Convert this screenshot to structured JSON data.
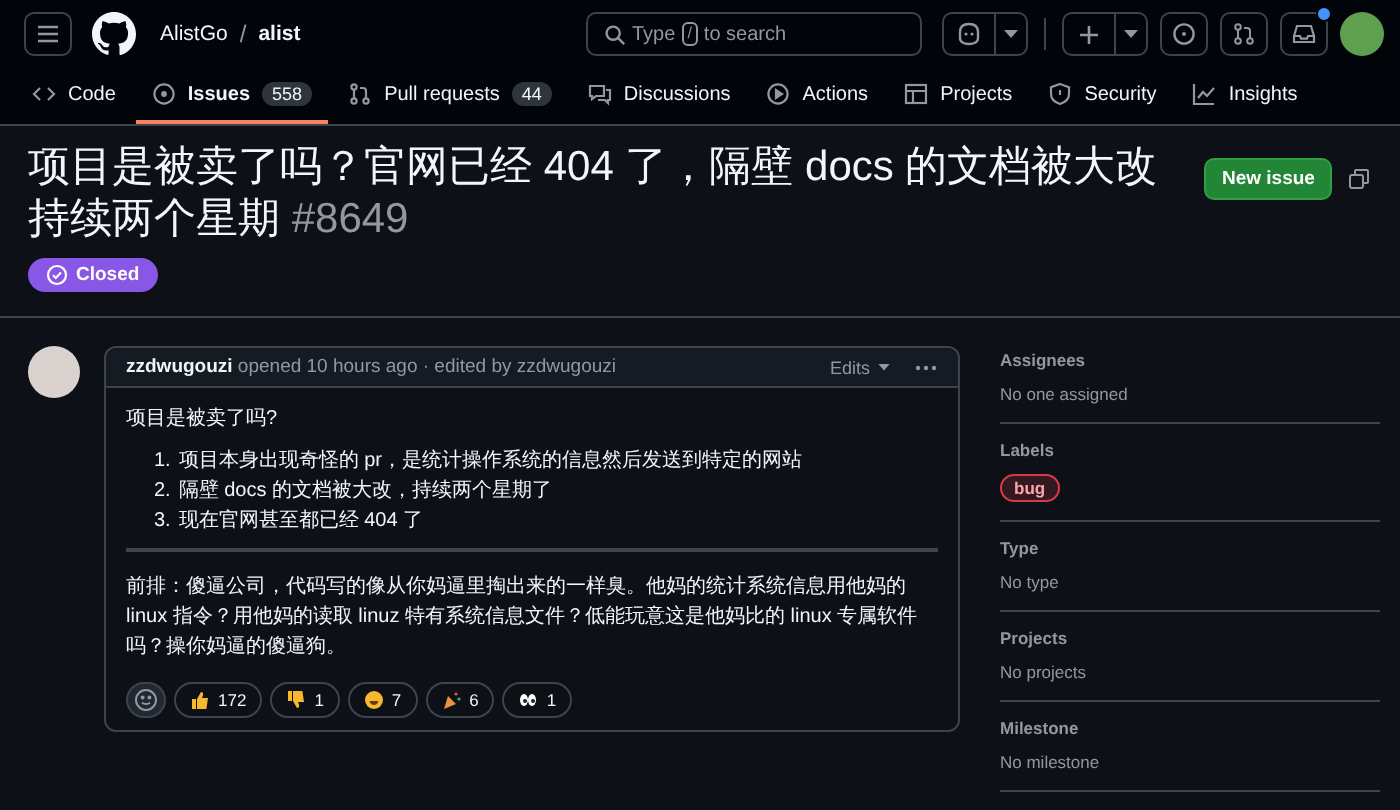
{
  "header": {
    "owner": "AlistGo",
    "separator": "/",
    "repo": "alist",
    "search": {
      "before": "Type",
      "key": "/",
      "after": "to search"
    },
    "notification_dot": true
  },
  "tabs": [
    {
      "label": "Code",
      "selected": false
    },
    {
      "label": "Issues",
      "count": "558",
      "selected": true
    },
    {
      "label": "Pull requests",
      "count": "44",
      "selected": false
    },
    {
      "label": "Discussions",
      "selected": false
    },
    {
      "label": "Actions",
      "selected": false
    },
    {
      "label": "Projects",
      "selected": false
    },
    {
      "label": "Security",
      "selected": false
    },
    {
      "label": "Insights",
      "selected": false
    }
  ],
  "issue": {
    "title": "项目是被卖了吗？官网已经 404 了，隔壁 docs 的文档被大改持续两个星期",
    "number": "#8649",
    "closed": true,
    "state_label": "Closed",
    "new_issue": "New issue"
  },
  "comment": {
    "author": "zzdwugouzi",
    "meta": "opened 10 hours ago · edited by zzdwugouzi",
    "edits": "Edits",
    "intro": "项目是被卖了吗?",
    "list": [
      {
        "marker": "1.",
        "text": "项目本身出现奇怪的 pr，是统计操作系统的信息然后发送到特定的网站"
      },
      {
        "marker": "2.",
        "text": "隔壁 docs 的文档被大改，持续两个星期了"
      },
      {
        "marker": "3.",
        "text": "现在官网甚至都已经 404 了"
      }
    ],
    "quote": "前排：傻逼公司，代码写的像从你妈逼里掏出来的一样臭。他妈的统计系统信息用他妈的 linux 指令？用他妈的读取 linuz 特有系统信息文件？低能玩意这是他妈比的 linux 专属软件吗？操你妈逼的傻逼狗。",
    "reactions": [
      {
        "kind": "thumbsup",
        "count": "172"
      },
      {
        "kind": "thumbsdown",
        "count": "1"
      },
      {
        "kind": "laugh",
        "count": "7"
      },
      {
        "kind": "hooray",
        "count": "6"
      },
      {
        "kind": "eyes",
        "count": "1"
      }
    ]
  },
  "sidebar": [
    {
      "heading": "Assignees",
      "value": "No one assigned"
    },
    {
      "heading": "Labels",
      "labels": [
        {
          "name": "bug",
          "color": "#d73a4a"
        }
      ]
    },
    {
      "heading": "Type",
      "value": "No type"
    },
    {
      "heading": "Projects",
      "value": "No projects"
    },
    {
      "heading": "Milestone",
      "value": "No milestone"
    }
  ]
}
